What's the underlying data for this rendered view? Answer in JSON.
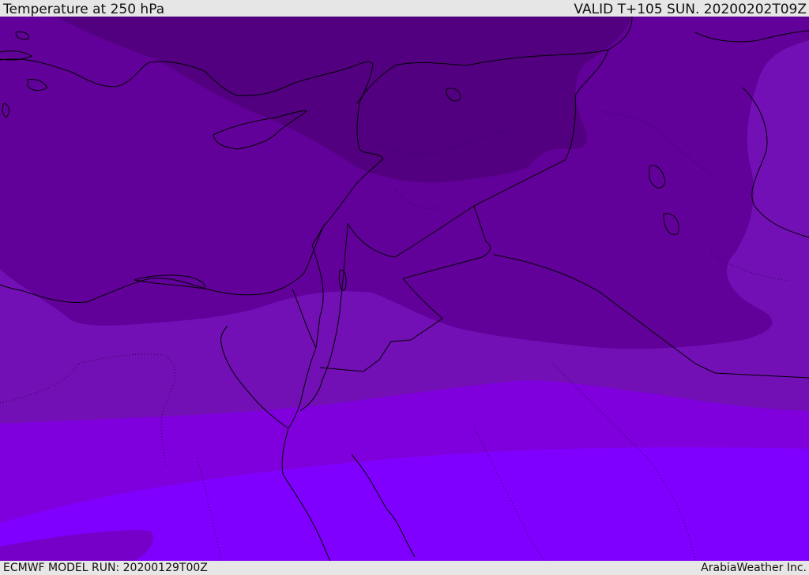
{
  "header": {
    "title": "Temperature at 250 hPa",
    "valid_time": "VALID T+105 SUN. 20200202T09Z"
  },
  "footer": {
    "model_run": "ECMWF MODEL RUN: 20200129T00Z",
    "credit": "ArabiaWeather Inc."
  },
  "map": {
    "variable": "temperature",
    "level": "250 hPa",
    "region": "Eastern Mediterranean, Levant and Middle East",
    "fill_colors": {
      "coldest": "#520080",
      "cold": "#62009a",
      "mid": "#7210b5",
      "warm": "#7f00dc",
      "warmest": "#8000ff"
    },
    "coastline_color": "#000000"
  }
}
